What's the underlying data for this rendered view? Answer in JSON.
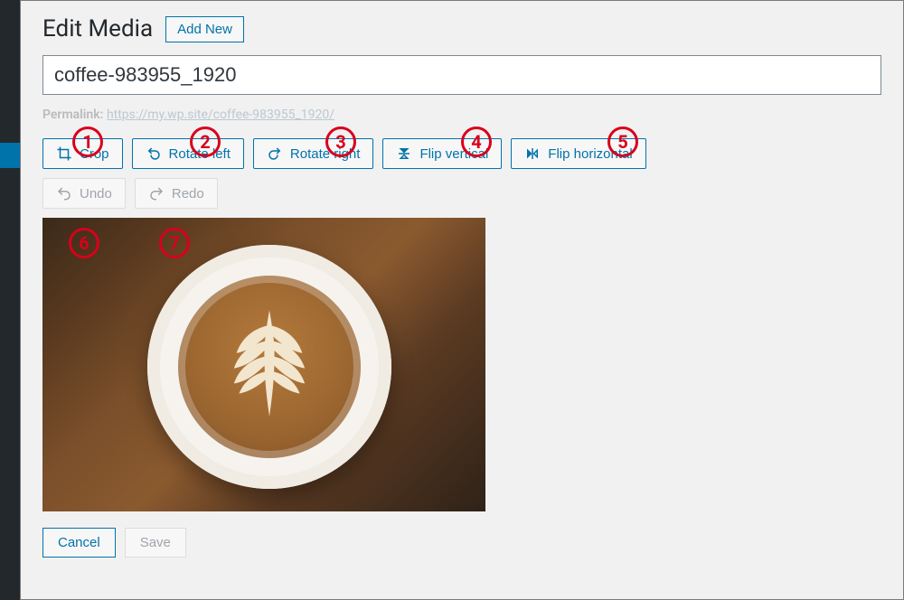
{
  "header": {
    "page_title": "Edit Media",
    "add_new_label": "Add New"
  },
  "title_input": {
    "value": "coffee-983955_1920"
  },
  "permalink": {
    "label": "Permalink:",
    "url_text": "https://my.wp.site/coffee-983955_1920/"
  },
  "toolbar": {
    "crop_label": "Crop",
    "rotate_left_label": "Rotate left",
    "rotate_right_label": "Rotate right",
    "flip_vertical_label": "Flip vertical",
    "flip_horizontal_label": "Flip horizontal"
  },
  "history": {
    "undo_label": "Undo",
    "redo_label": "Redo"
  },
  "footer": {
    "cancel_label": "Cancel",
    "save_label": "Save"
  },
  "annotations": {
    "n1": "1",
    "n2": "2",
    "n3": "3",
    "n4": "4",
    "n5": "5",
    "n6": "6",
    "n7": "7"
  }
}
